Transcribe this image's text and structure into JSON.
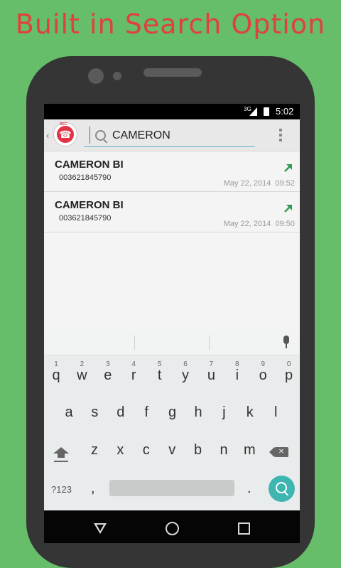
{
  "promo_title": "Built in Search Option",
  "status": {
    "network": "3G",
    "time": "5:02"
  },
  "header": {
    "search_value": "CAMERON",
    "logo_text": "REC"
  },
  "calls": [
    {
      "name": "CAMERON BI",
      "number": "003621845790",
      "date": "May 22, 2014",
      "time": "09:52"
    },
    {
      "name": "CAMERON BI",
      "number": "003621845790",
      "date": "May 22, 2014",
      "time": "09:50"
    }
  ],
  "colors": {
    "outgoing_arrow": "#2e9b52",
    "accent": "#3fb5b2",
    "logo_red": "#e23446"
  },
  "keyboard": {
    "row1": [
      {
        "k": "q",
        "h": "1"
      },
      {
        "k": "w",
        "h": "2"
      },
      {
        "k": "e",
        "h": "3"
      },
      {
        "k": "r",
        "h": "4"
      },
      {
        "k": "t",
        "h": "5"
      },
      {
        "k": "y",
        "h": "6"
      },
      {
        "k": "u",
        "h": "7"
      },
      {
        "k": "i",
        "h": "8"
      },
      {
        "k": "o",
        "h": "9"
      },
      {
        "k": "p",
        "h": "0"
      }
    ],
    "row2": [
      "a",
      "s",
      "d",
      "f",
      "g",
      "h",
      "j",
      "k",
      "l"
    ],
    "row3": [
      "z",
      "x",
      "c",
      "v",
      "b",
      "n",
      "m"
    ],
    "symbols_label": "?123",
    "comma": ",",
    "period": "."
  }
}
